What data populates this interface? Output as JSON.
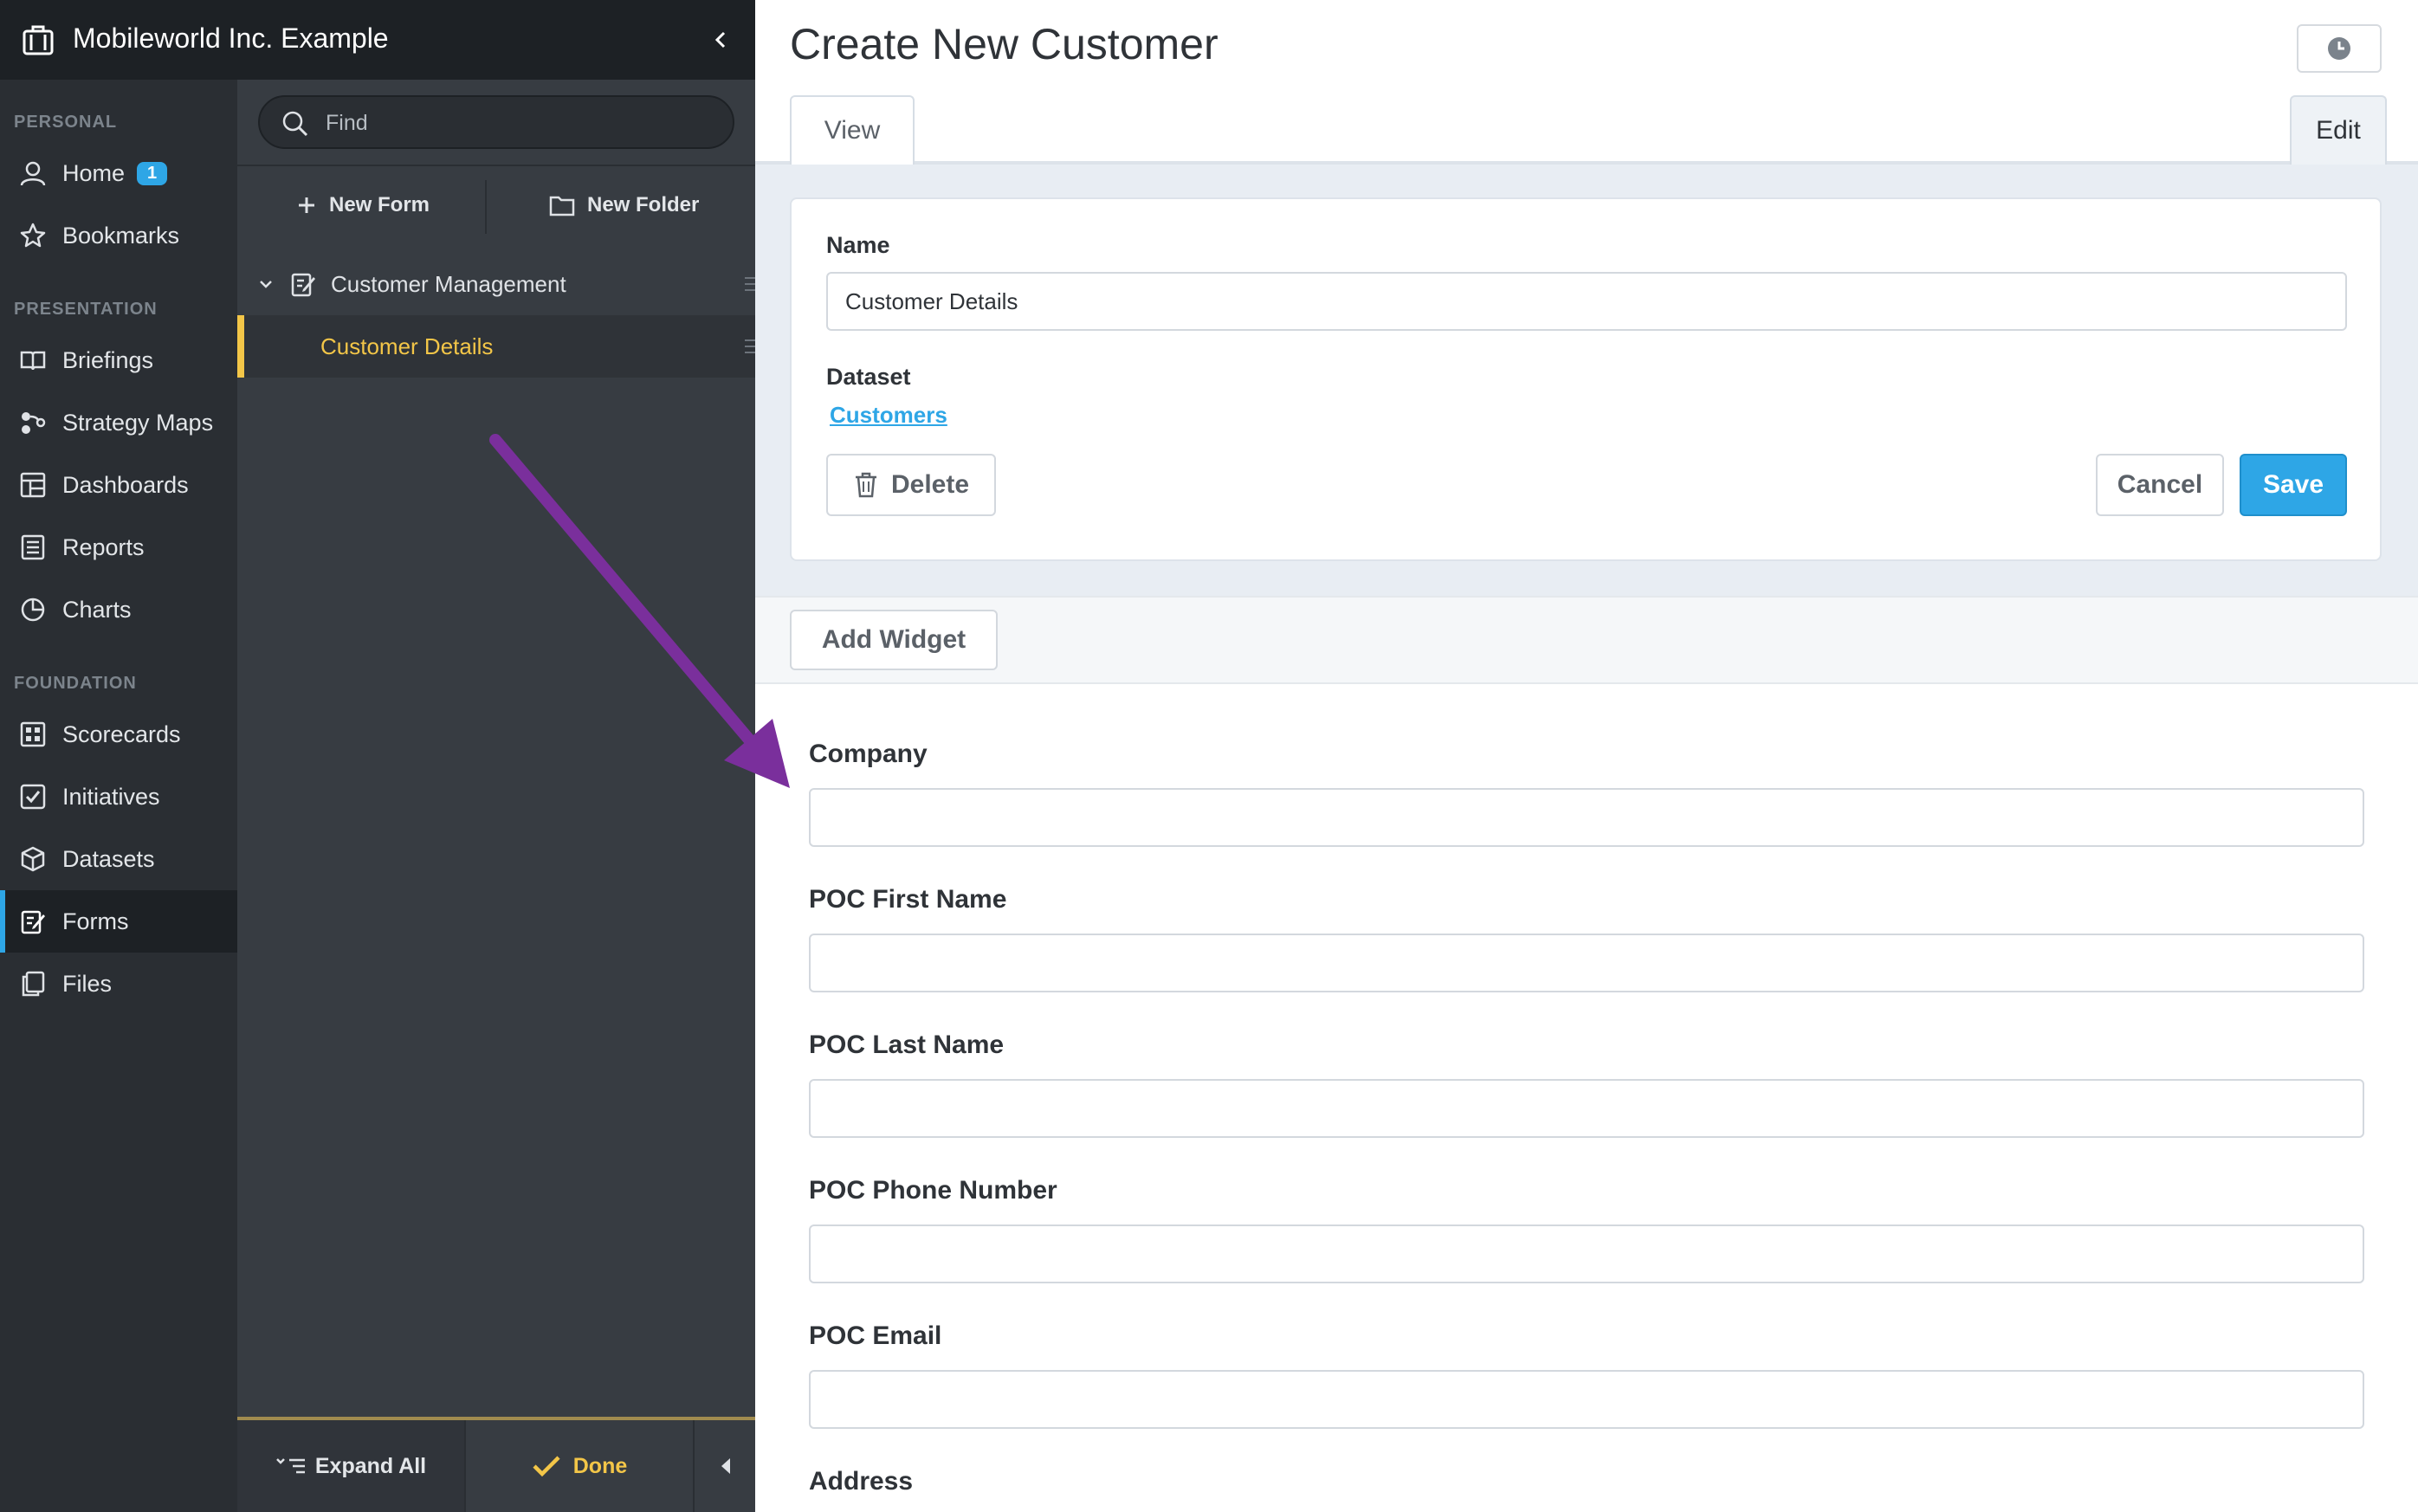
{
  "app": {
    "title": "Mobileworld Inc. Example",
    "collapse_icon": "chevron-left-icon"
  },
  "nav": {
    "sections": {
      "personal": "PERSONAL",
      "presentation": "PRESENTATION",
      "foundation": "FOUNDATION"
    },
    "items": [
      {
        "label": "Home",
        "icon": "user-icon",
        "badge": "1"
      },
      {
        "label": "Bookmarks",
        "icon": "star-icon"
      },
      {
        "label": "Briefings",
        "icon": "book-icon"
      },
      {
        "label": "Strategy Maps",
        "icon": "strategy-map-icon"
      },
      {
        "label": "Dashboards",
        "icon": "dashboard-icon"
      },
      {
        "label": "Reports",
        "icon": "report-icon"
      },
      {
        "label": "Charts",
        "icon": "pie-chart-icon"
      },
      {
        "label": "Scorecards",
        "icon": "scorecard-icon"
      },
      {
        "label": "Initiatives",
        "icon": "checkbox-icon"
      },
      {
        "label": "Datasets",
        "icon": "cube-icon"
      },
      {
        "label": "Forms",
        "icon": "form-icon",
        "active": true
      },
      {
        "label": "Files",
        "icon": "files-icon"
      }
    ]
  },
  "tree": {
    "search_placeholder": "Find",
    "new_form": "New Form",
    "new_folder": "New Folder",
    "folder": "Customer Management",
    "selected_item": "Customer Details",
    "expand_all": "Expand All",
    "done": "Done"
  },
  "main": {
    "page_title": "Create New Customer",
    "tabs": {
      "view": "View",
      "edit": "Edit"
    },
    "form": {
      "name_label": "Name",
      "name_value": "Customer Details",
      "dataset_label": "Dataset",
      "dataset_link": "Customers",
      "delete": "Delete",
      "cancel": "Cancel",
      "save": "Save"
    },
    "add_widget": "Add Widget",
    "fields": [
      {
        "label": "Company"
      },
      {
        "label": "POC First Name"
      },
      {
        "label": "POC Last Name"
      },
      {
        "label": "POC Phone Number"
      },
      {
        "label": "POC Email"
      },
      {
        "label": "Address"
      }
    ]
  },
  "colors": {
    "accent_blue": "#2ea6e6",
    "selected_yellow": "#f3c648",
    "annotation_purple": "#7a2f9c"
  }
}
